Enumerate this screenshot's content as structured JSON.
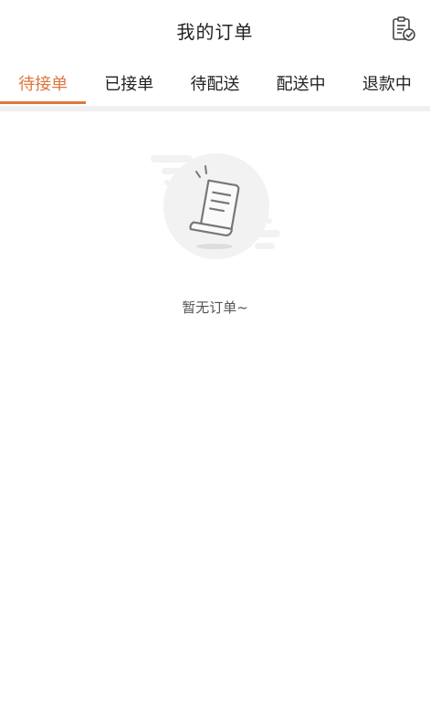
{
  "header": {
    "title": "我的订单",
    "icon": "clipboard-check-icon"
  },
  "tabs": [
    {
      "label": "待接单",
      "active": true
    },
    {
      "label": "已接单",
      "active": false
    },
    {
      "label": "待配送",
      "active": false
    },
    {
      "label": "配送中",
      "active": false
    },
    {
      "label": "退款中",
      "active": false
    }
  ],
  "empty_state": {
    "icon": "empty-receipt-icon",
    "text": "暂无订单~"
  },
  "colors": {
    "accent": "#e0763c",
    "divider": "#f0f0f0",
    "text": "#222222"
  }
}
